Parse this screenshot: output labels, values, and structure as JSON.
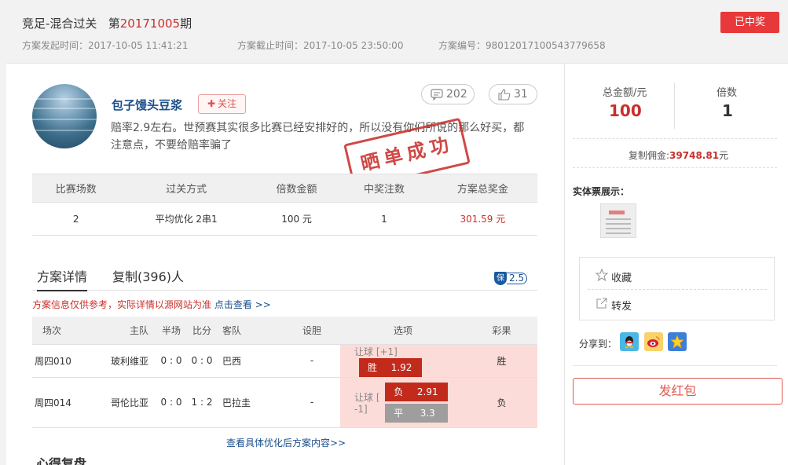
{
  "header": {
    "title_prefix": "竞足-混合过关",
    "title_di": "第",
    "issue": "20171005",
    "title_suffix": "期",
    "status": "已中奖",
    "created_label": "方案发起时间：2017-10-05 11:41:21",
    "deadline_label": "方案截止时间：2017-10-05 23:50:00",
    "code_label": "方案编号：98012017100543779658"
  },
  "user": {
    "name": "包子馒头豆浆",
    "follow": "关注",
    "comments": "202",
    "likes": "31",
    "description": "赔率2.9左右。世预赛其实很多比赛已经安排好的，所以没有你们所说的那么好买，都注意点，不要给赔率骗了",
    "stamp": "晒单成功"
  },
  "summary": {
    "headers": [
      "比赛场数",
      "过关方式",
      "倍数金额",
      "中奖注数",
      "方案总奖金"
    ],
    "values": [
      "2",
      "平均优化 2串1",
      "100 元",
      "1",
      "301.59 元"
    ]
  },
  "tabs": {
    "detail": "方案详情",
    "copy": "复制(396)人",
    "bao_char": "保",
    "bao_value": "2.5"
  },
  "note": {
    "text": "方案信息仅供参考，实际详情以源网站为准",
    "link": "点击查看 >>"
  },
  "matches": {
    "headers": [
      "场次",
      "主队",
      "半场",
      "比分",
      "客队",
      "设胆",
      "选项",
      "彩果"
    ],
    "rows": [
      {
        "id": "周四010",
        "home": "玻利维亚",
        "half": "0 : 0",
        "score": "0 : 0",
        "away": "巴西",
        "dan": "-",
        "handicap": "让球 [+1]",
        "options": [
          {
            "k": "胜",
            "v": "1.92",
            "style": "red"
          }
        ],
        "result": "胜"
      },
      {
        "id": "周四014",
        "home": "哥伦比亚",
        "half": "0 : 0",
        "score": "1 : 2",
        "away": "巴拉圭",
        "dan": "-",
        "handicap": "让球 [ -1]",
        "options": [
          {
            "k": "负",
            "v": "2.91",
            "style": "red"
          },
          {
            "k": "平",
            "v": "3.3",
            "style": "gray"
          }
        ],
        "result": "负"
      }
    ]
  },
  "more_link": "查看具体优化后方案内容>>",
  "section2_title": "心得复盘",
  "side": {
    "total_label": "总金额/元",
    "total_value": "100",
    "multiple_label": "倍数",
    "multiple_value": "1",
    "commission_label": "复制佣金:",
    "commission_value": "39748.81",
    "commission_unit": "元",
    "ticket_label": "实体票展示：",
    "collect": "收藏",
    "forward": "转发",
    "share_label": "分享到：",
    "red_packet": "发红包"
  },
  "colors": {
    "accent_red": "#c9302c",
    "link_blue": "#1a4f8b",
    "win_red": "#e8393a"
  }
}
